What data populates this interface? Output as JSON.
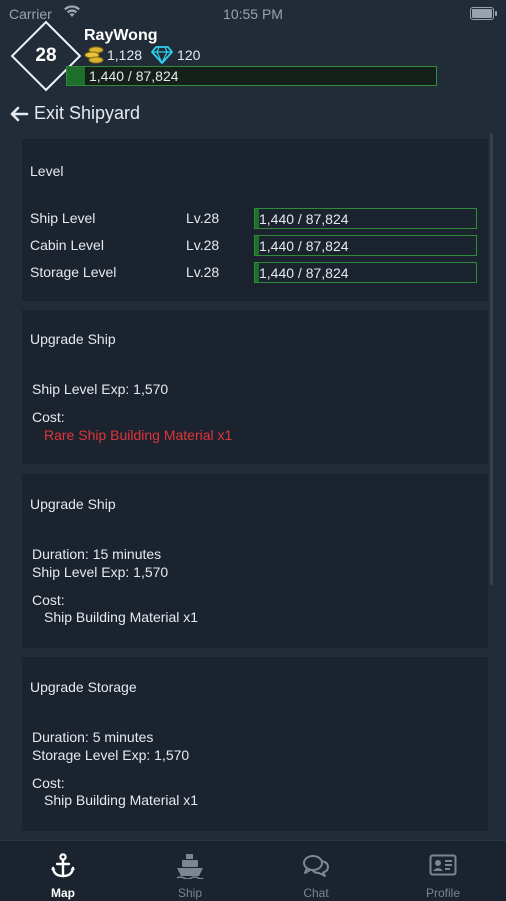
{
  "status_bar": {
    "carrier": "Carrier",
    "time": "10:55 PM"
  },
  "profile": {
    "level": "28",
    "username": "RayWong",
    "coins": "1,128",
    "gems": "120",
    "xp_text": "1,440 / 87,824",
    "xp_fraction": 0.0164
  },
  "nav": {
    "back_label": "Exit Shipyard"
  },
  "level_card": {
    "title": "Level",
    "rows": [
      {
        "label": "Ship Level",
        "level": "Lv.28",
        "progress": "1,440 / 87,824",
        "fraction": 0.0164
      },
      {
        "label": "Cabin Level",
        "level": "Lv.28",
        "progress": "1,440 / 87,824",
        "fraction": 0.0164
      },
      {
        "label": "Storage Level",
        "level": "Lv.28",
        "progress": "1,440 / 87,824",
        "fraction": 0.0164
      }
    ]
  },
  "upgrade_cards": [
    {
      "title": "Upgrade Ship",
      "exp": "Ship Level Exp: 1,570",
      "cost_label": "Cost:",
      "material": "Rare Ship Building Material x1",
      "material_color": "#e0353b"
    },
    {
      "title": "Upgrade Ship",
      "duration": "Duration: 15 minutes",
      "exp": "Ship Level Exp: 1,570",
      "cost_label": "Cost:",
      "material": "Ship Building Material x1"
    },
    {
      "title": "Upgrade Storage",
      "duration": "Duration: 5 minutes",
      "exp": "Storage Level Exp: 1,570",
      "cost_label": "Cost:",
      "material": "Ship Building Material x1"
    }
  ],
  "tabs": [
    {
      "label": "Map",
      "icon": "anchor-icon",
      "active": true
    },
    {
      "label": "Ship",
      "icon": "ship-icon",
      "active": false
    },
    {
      "label": "Chat",
      "icon": "chat-icon",
      "active": false
    },
    {
      "label": "Profile",
      "icon": "profile-card-icon",
      "active": false
    }
  ],
  "colors": {
    "background": "#222c38",
    "card": "#1b232e",
    "progress_green": "#1e6e2c",
    "progress_border": "#2f8a3a",
    "warning_red": "#e0353b"
  }
}
